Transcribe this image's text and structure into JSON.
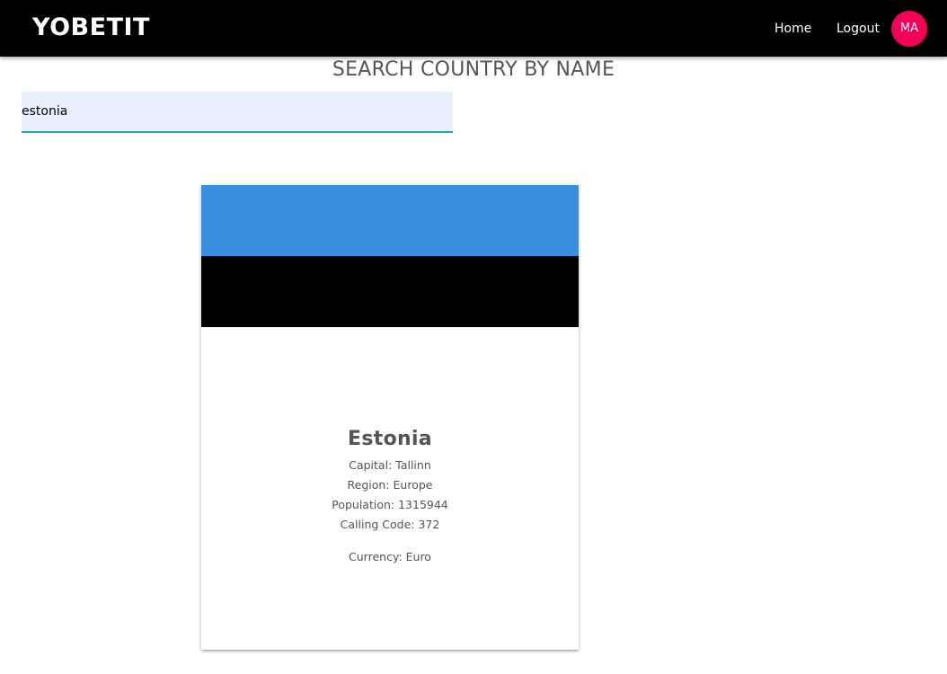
{
  "header": {
    "brand": "YOBETIT",
    "nav": {
      "home_label": "Home",
      "logout_label": "Logout"
    },
    "avatar_initials": "MA",
    "avatar_color": "#f50057"
  },
  "main": {
    "title": "SEARCH COUNTRY BY NAME",
    "search": {
      "value": "estonia",
      "placeholder": ""
    },
    "country_card": {
      "flag": {
        "stripes": [
          "#398ddd",
          "#000000",
          "#ffffff"
        ]
      },
      "name": "Estonia",
      "capital_text": "Capital: Tallinn",
      "region_text": "Region: Europe",
      "population_text": "Population: 1315944",
      "calling_code_text": "Calling Code: 372",
      "currency_text": "Currency: Euro"
    }
  }
}
